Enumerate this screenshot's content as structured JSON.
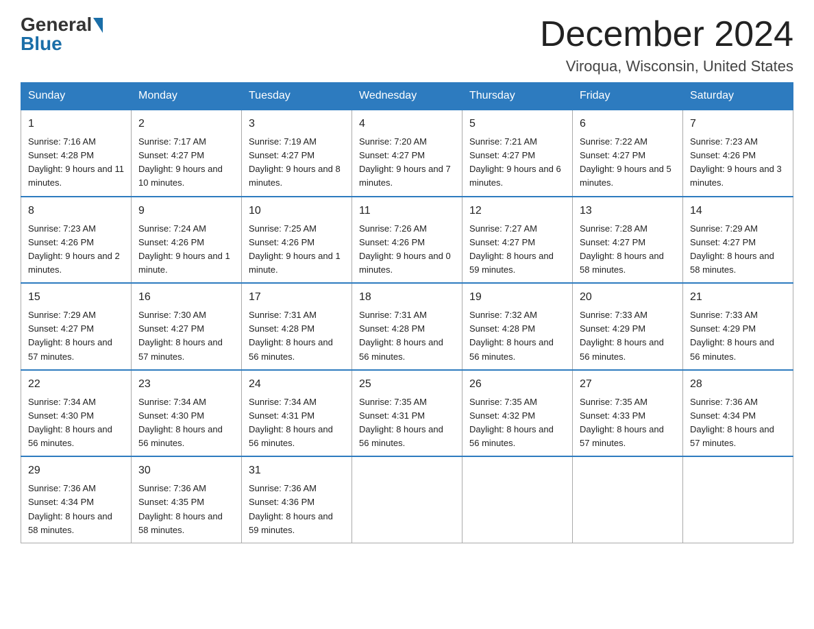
{
  "header": {
    "logo_general": "General",
    "logo_blue": "Blue",
    "month_title": "December 2024",
    "location": "Viroqua, Wisconsin, United States"
  },
  "days_of_week": [
    "Sunday",
    "Monday",
    "Tuesday",
    "Wednesday",
    "Thursday",
    "Friday",
    "Saturday"
  ],
  "weeks": [
    [
      {
        "day": "1",
        "sunrise": "7:16 AM",
        "sunset": "4:28 PM",
        "daylight": "9 hours and 11 minutes."
      },
      {
        "day": "2",
        "sunrise": "7:17 AM",
        "sunset": "4:27 PM",
        "daylight": "9 hours and 10 minutes."
      },
      {
        "day": "3",
        "sunrise": "7:19 AM",
        "sunset": "4:27 PM",
        "daylight": "9 hours and 8 minutes."
      },
      {
        "day": "4",
        "sunrise": "7:20 AM",
        "sunset": "4:27 PM",
        "daylight": "9 hours and 7 minutes."
      },
      {
        "day": "5",
        "sunrise": "7:21 AM",
        "sunset": "4:27 PM",
        "daylight": "9 hours and 6 minutes."
      },
      {
        "day": "6",
        "sunrise": "7:22 AM",
        "sunset": "4:27 PM",
        "daylight": "9 hours and 5 minutes."
      },
      {
        "day": "7",
        "sunrise": "7:23 AM",
        "sunset": "4:26 PM",
        "daylight": "9 hours and 3 minutes."
      }
    ],
    [
      {
        "day": "8",
        "sunrise": "7:23 AM",
        "sunset": "4:26 PM",
        "daylight": "9 hours and 2 minutes."
      },
      {
        "day": "9",
        "sunrise": "7:24 AM",
        "sunset": "4:26 PM",
        "daylight": "9 hours and 1 minute."
      },
      {
        "day": "10",
        "sunrise": "7:25 AM",
        "sunset": "4:26 PM",
        "daylight": "9 hours and 1 minute."
      },
      {
        "day": "11",
        "sunrise": "7:26 AM",
        "sunset": "4:26 PM",
        "daylight": "9 hours and 0 minutes."
      },
      {
        "day": "12",
        "sunrise": "7:27 AM",
        "sunset": "4:27 PM",
        "daylight": "8 hours and 59 minutes."
      },
      {
        "day": "13",
        "sunrise": "7:28 AM",
        "sunset": "4:27 PM",
        "daylight": "8 hours and 58 minutes."
      },
      {
        "day": "14",
        "sunrise": "7:29 AM",
        "sunset": "4:27 PM",
        "daylight": "8 hours and 58 minutes."
      }
    ],
    [
      {
        "day": "15",
        "sunrise": "7:29 AM",
        "sunset": "4:27 PM",
        "daylight": "8 hours and 57 minutes."
      },
      {
        "day": "16",
        "sunrise": "7:30 AM",
        "sunset": "4:27 PM",
        "daylight": "8 hours and 57 minutes."
      },
      {
        "day": "17",
        "sunrise": "7:31 AM",
        "sunset": "4:28 PM",
        "daylight": "8 hours and 56 minutes."
      },
      {
        "day": "18",
        "sunrise": "7:31 AM",
        "sunset": "4:28 PM",
        "daylight": "8 hours and 56 minutes."
      },
      {
        "day": "19",
        "sunrise": "7:32 AM",
        "sunset": "4:28 PM",
        "daylight": "8 hours and 56 minutes."
      },
      {
        "day": "20",
        "sunrise": "7:33 AM",
        "sunset": "4:29 PM",
        "daylight": "8 hours and 56 minutes."
      },
      {
        "day": "21",
        "sunrise": "7:33 AM",
        "sunset": "4:29 PM",
        "daylight": "8 hours and 56 minutes."
      }
    ],
    [
      {
        "day": "22",
        "sunrise": "7:34 AM",
        "sunset": "4:30 PM",
        "daylight": "8 hours and 56 minutes."
      },
      {
        "day": "23",
        "sunrise": "7:34 AM",
        "sunset": "4:30 PM",
        "daylight": "8 hours and 56 minutes."
      },
      {
        "day": "24",
        "sunrise": "7:34 AM",
        "sunset": "4:31 PM",
        "daylight": "8 hours and 56 minutes."
      },
      {
        "day": "25",
        "sunrise": "7:35 AM",
        "sunset": "4:31 PM",
        "daylight": "8 hours and 56 minutes."
      },
      {
        "day": "26",
        "sunrise": "7:35 AM",
        "sunset": "4:32 PM",
        "daylight": "8 hours and 56 minutes."
      },
      {
        "day": "27",
        "sunrise": "7:35 AM",
        "sunset": "4:33 PM",
        "daylight": "8 hours and 57 minutes."
      },
      {
        "day": "28",
        "sunrise": "7:36 AM",
        "sunset": "4:34 PM",
        "daylight": "8 hours and 57 minutes."
      }
    ],
    [
      {
        "day": "29",
        "sunrise": "7:36 AM",
        "sunset": "4:34 PM",
        "daylight": "8 hours and 58 minutes."
      },
      {
        "day": "30",
        "sunrise": "7:36 AM",
        "sunset": "4:35 PM",
        "daylight": "8 hours and 58 minutes."
      },
      {
        "day": "31",
        "sunrise": "7:36 AM",
        "sunset": "4:36 PM",
        "daylight": "8 hours and 59 minutes."
      },
      {
        "day": "",
        "sunrise": "",
        "sunset": "",
        "daylight": ""
      },
      {
        "day": "",
        "sunrise": "",
        "sunset": "",
        "daylight": ""
      },
      {
        "day": "",
        "sunrise": "",
        "sunset": "",
        "daylight": ""
      },
      {
        "day": "",
        "sunrise": "",
        "sunset": "",
        "daylight": ""
      }
    ]
  ]
}
